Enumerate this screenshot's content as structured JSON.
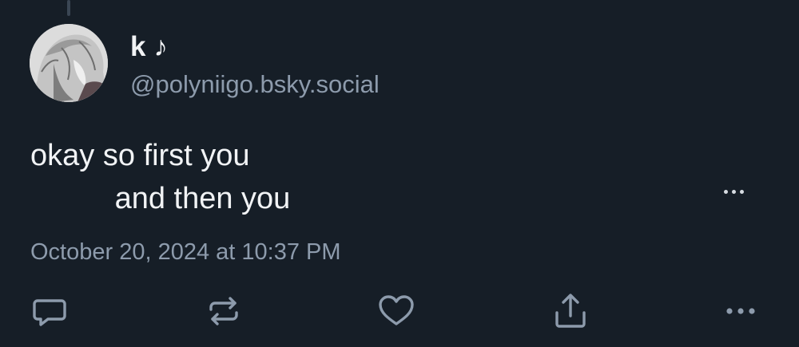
{
  "post": {
    "author": {
      "display_name": "k ♪",
      "handle": "@polyniigo.bsky.social"
    },
    "text": "okay so first you\n          and then you",
    "timestamp": "October 20, 2024 at 10:37 PM"
  },
  "icons": {
    "reply": "reply-icon",
    "repost": "repost-icon",
    "like": "heart-icon",
    "share": "share-icon",
    "more": "more-icon"
  },
  "colors": {
    "background": "#161e27",
    "primary_text": "#f1f3f5",
    "secondary_text": "#8d9bac",
    "icon": "#8d9bac"
  }
}
